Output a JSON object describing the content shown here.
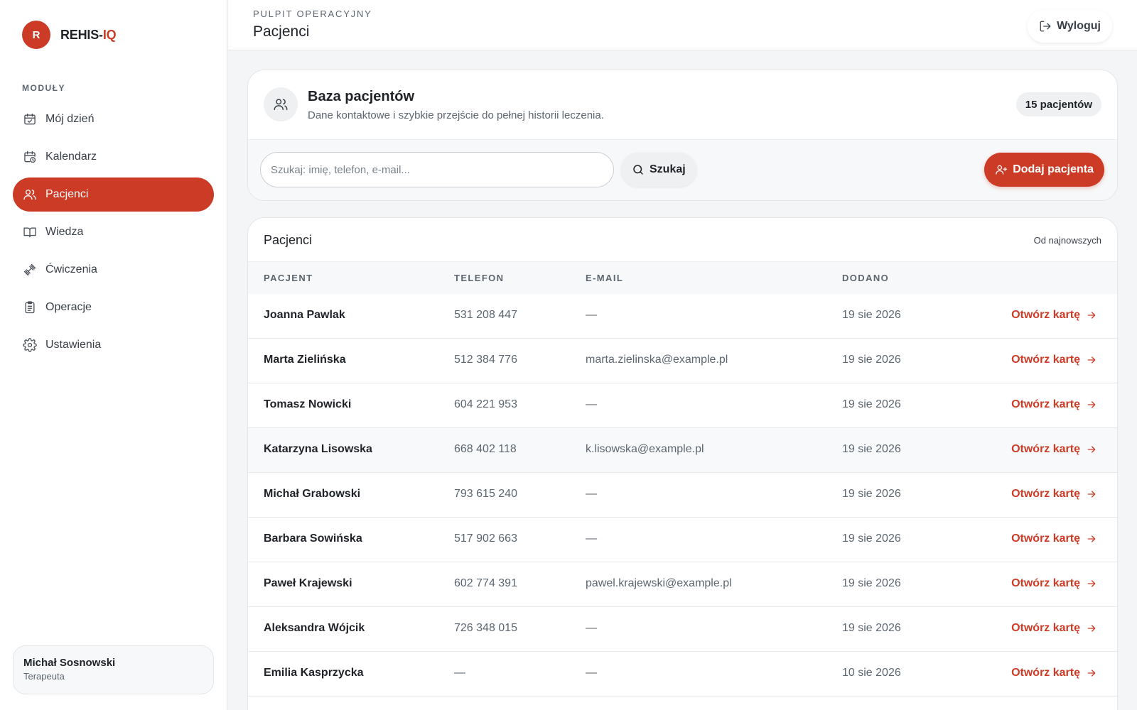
{
  "brand": {
    "initial": "R",
    "name_prefix": "REHIS-",
    "name_accent": "IQ",
    "accent_color": "#cc3b26"
  },
  "sidebar": {
    "heading": "MODUŁY",
    "items": [
      {
        "label": "Mój dzień",
        "icon": "calendar-check-icon",
        "active": false
      },
      {
        "label": "Kalendarz",
        "icon": "calendar-clock-icon",
        "active": false
      },
      {
        "label": "Pacjenci",
        "icon": "users-icon",
        "active": true
      },
      {
        "label": "Wiedza",
        "icon": "book-icon",
        "active": false
      },
      {
        "label": "Ćwiczenia",
        "icon": "dumbbell-icon",
        "active": false
      },
      {
        "label": "Operacje",
        "icon": "clipboard-icon",
        "active": false
      },
      {
        "label": "Ustawienia",
        "icon": "gear-icon",
        "active": false
      }
    ]
  },
  "user": {
    "name": "Michał Sosnowski",
    "role": "Terapeuta"
  },
  "header": {
    "eyebrow": "PULPIT OPERACYJNY",
    "title": "Pacjenci",
    "logout_label": "Wyloguj"
  },
  "database": {
    "title": "Baza pacjentów",
    "subtitle": "Dane kontaktowe i szybkie przejście do pełnej historii leczenia.",
    "count_label": "15 pacjentów",
    "search_placeholder": "Szukaj: imię, telefon, e-mail...",
    "search_value": "",
    "search_button": "Szukaj",
    "add_button": "Dodaj pacjenta"
  },
  "table": {
    "title": "Pacjenci",
    "sort_label": "Od najnowszych",
    "columns": [
      "PACJENT",
      "TELEFON",
      "E-MAIL",
      "DODANO"
    ],
    "open_label": "Otwórz kartę",
    "rows": [
      {
        "name": "Joanna Pawlak",
        "phone": "531 208 447",
        "email": "—",
        "added": "19 sie 2026"
      },
      {
        "name": "Marta Zielińska",
        "phone": "512 384 776",
        "email": "marta.zielinska@example.pl",
        "added": "19 sie 2026"
      },
      {
        "name": "Tomasz Nowicki",
        "phone": "604 221 953",
        "email": "—",
        "added": "19 sie 2026"
      },
      {
        "name": "Katarzyna Lisowska",
        "phone": "668 402 118",
        "email": "k.lisowska@example.pl",
        "added": "19 sie 2026"
      },
      {
        "name": "Michał Grabowski",
        "phone": "793 615 240",
        "email": "—",
        "added": "19 sie 2026"
      },
      {
        "name": "Barbara Sowińska",
        "phone": "517 902 663",
        "email": "—",
        "added": "19 sie 2026"
      },
      {
        "name": "Paweł Krajewski",
        "phone": "602 774 391",
        "email": "pawel.krajewski@example.pl",
        "added": "19 sie 2026"
      },
      {
        "name": "Aleksandra Wójcik",
        "phone": "726 348 015",
        "email": "—",
        "added": "19 sie 2026"
      },
      {
        "name": "Emilia Kasprzycka",
        "phone": "—",
        "email": "—",
        "added": "10 sie 2026"
      }
    ]
  }
}
